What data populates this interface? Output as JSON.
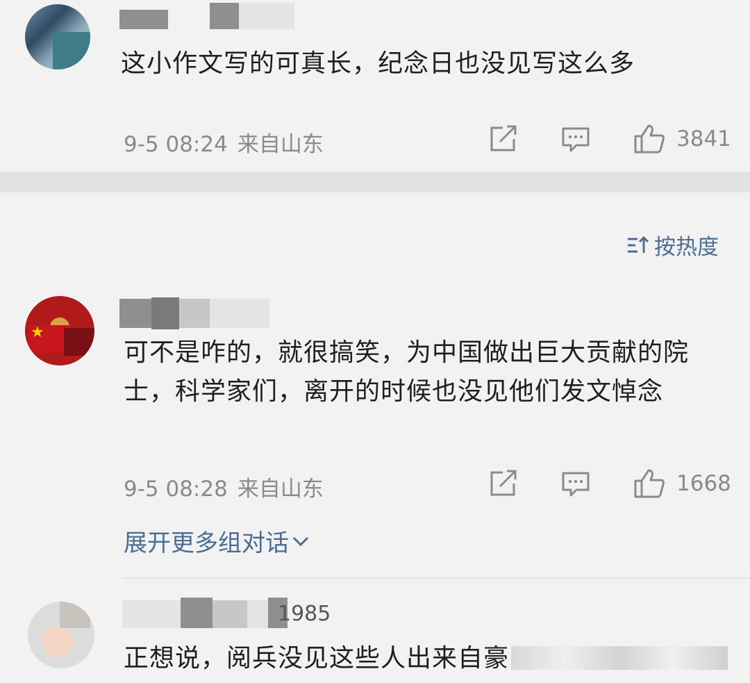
{
  "sort": {
    "label": "按热度"
  },
  "comments": [
    {
      "username_visible": "",
      "text": "这小作文写的可真长，纪念日也没见写这么多",
      "time": "9-5 08:24",
      "location": "来自山东",
      "likes": "3841"
    },
    {
      "username_visible": "",
      "text": "可不是咋的，就很搞笑，为中国做出巨大贡献的院士，科学家们，离开的时候也没见他们发文悼念",
      "time": "9-5 08:28",
      "location": "来自山东",
      "likes": "1668",
      "expand_label": "展开更多组对话"
    },
    {
      "username_visible": "1985",
      "text": "正想说，阅兵没见这些人出来自豪",
      "time": "",
      "location": "",
      "likes": ""
    }
  ],
  "icons": {
    "share": "share-icon",
    "comment": "comment-icon",
    "like": "thumbs-up-icon",
    "sort": "sort-icon",
    "expand": "chevron-down-icon"
  },
  "colors": {
    "link": "#4b6d93",
    "meta": "#8a8a8a",
    "background": "#f2f2f2"
  }
}
